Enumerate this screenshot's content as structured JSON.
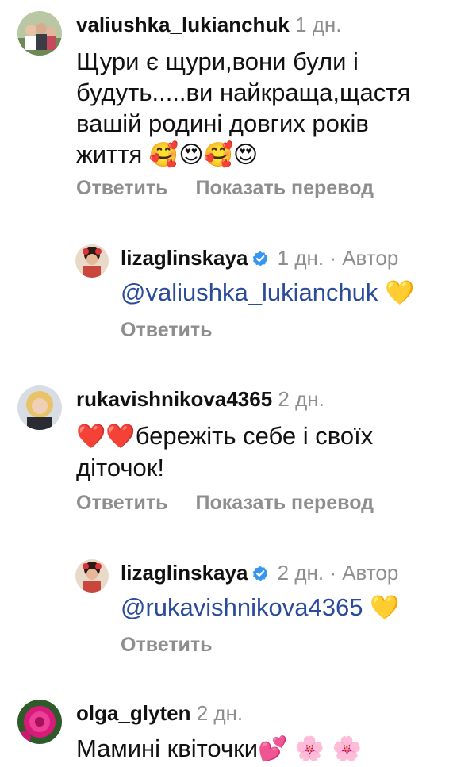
{
  "comments": [
    {
      "username": "valiushka_lukianchuk",
      "time": "1 дн.",
      "text": "Щури є щури,вони були і будуть.....ви найкраща,щастя вашій родині довгих років життя",
      "emojis": "🥰😍🥰😍",
      "actions": {
        "reply": "Ответить",
        "translate": "Показать перевод"
      }
    },
    {
      "username": "lizaglinskaya",
      "verified": true,
      "time": "1 дн.",
      "author_label": "· Автор",
      "mention": "@valiushka_lukianchuk",
      "emojis": "💛",
      "actions": {
        "reply": "Ответить"
      }
    },
    {
      "username": "rukavishnikova4365",
      "time": "2 дн.",
      "emojis_prefix": "❤️❤️",
      "text": "бережіть себе і своїх діточок!",
      "actions": {
        "reply": "Ответить",
        "translate": "Показать перевод"
      }
    },
    {
      "username": "lizaglinskaya",
      "verified": true,
      "time": "2 дн.",
      "author_label": "· Автор",
      "mention": "@rukavishnikova4365",
      "emojis": "💛",
      "actions": {
        "reply": "Ответить"
      }
    },
    {
      "username": "olga_glyten",
      "time": "2 дн.",
      "text": "Мамині квіточки",
      "emojis": "💕 🌸 🌸"
    }
  ],
  "colors": {
    "username": "#111111",
    "meta": "#8e8e8e",
    "mention": "#2a4a9c",
    "verified": "#3797f0"
  }
}
